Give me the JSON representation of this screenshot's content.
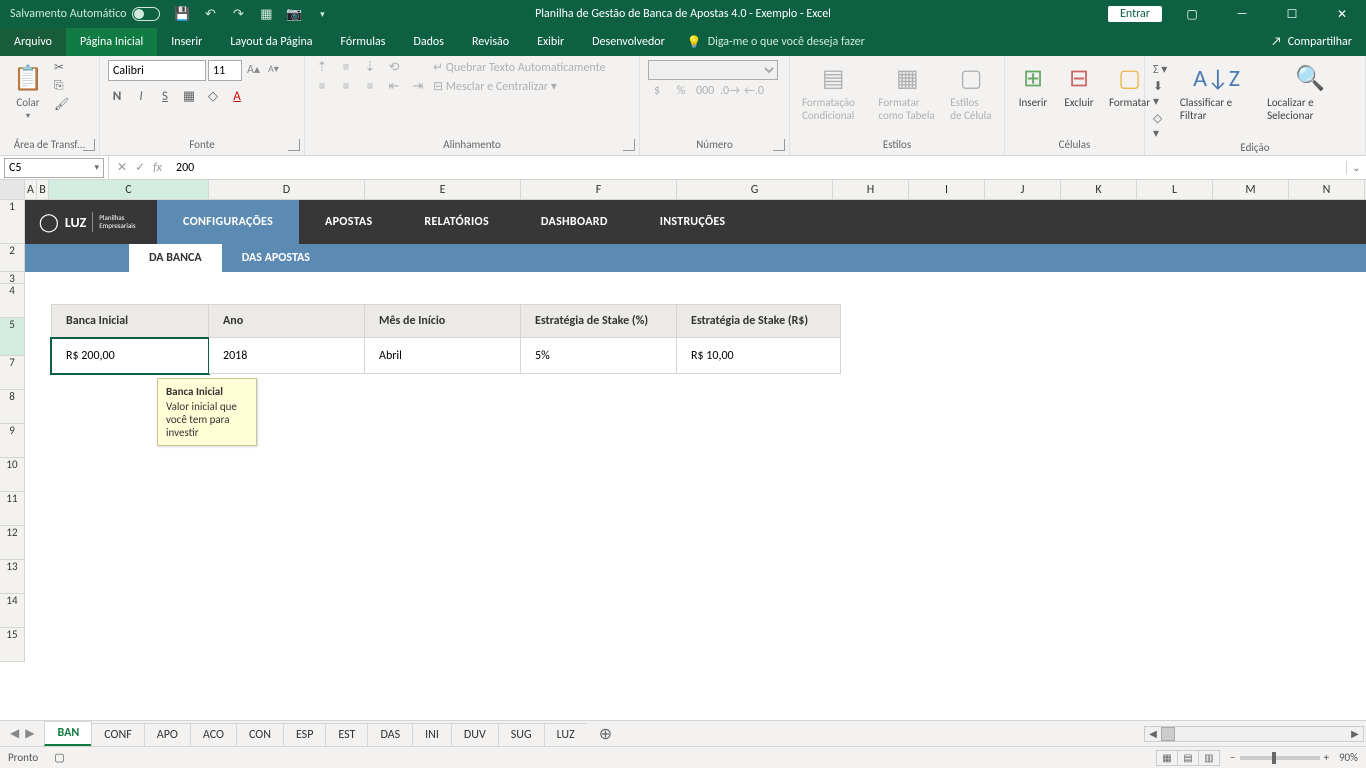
{
  "titlebar": {
    "autosave": "Salvamento Automático",
    "title": "Planilha de Gestão de Banca de Apostas 4.0 - Exemplo  -  Excel",
    "enter": "Entrar"
  },
  "menu": {
    "file": "Arquivo",
    "home": "Página Inicial",
    "insert": "Inserir",
    "layout": "Layout da Página",
    "formulas": "Fórmulas",
    "data": "Dados",
    "review": "Revisão",
    "view": "Exibir",
    "developer": "Desenvolvedor",
    "tellme": "Diga-me o que você deseja fazer",
    "share": "Compartilhar"
  },
  "ribbon": {
    "clipboard": {
      "paste": "Colar",
      "group": "Área de Transf..."
    },
    "font": {
      "name": "Calibri",
      "size": "11",
      "group": "Fonte"
    },
    "align": {
      "wrap": "Quebrar Texto Automaticamente",
      "merge": "Mesclar e Centralizar",
      "group": "Alinhamento"
    },
    "number": {
      "group": "Número"
    },
    "styles": {
      "cond": "Formatação Condicional",
      "table": "Formatar como Tabela",
      "cell": "Estilos de Célula",
      "group": "Estilos"
    },
    "cells": {
      "insert": "Inserir",
      "delete": "Excluir",
      "format": "Formatar",
      "group": "Células"
    },
    "editing": {
      "sort": "Classificar e Filtrar",
      "find": "Localizar e Selecionar",
      "group": "Edição"
    }
  },
  "namebox": "C5",
  "formula": "200",
  "colheads": [
    "A",
    "B",
    "C",
    "D",
    "E",
    "F",
    "G",
    "H",
    "I",
    "J",
    "K",
    "L",
    "M",
    "N"
  ],
  "rowheads": [
    "1",
    "2",
    "3",
    "4",
    "5",
    "7",
    "8",
    "9",
    "10",
    "11",
    "12",
    "13",
    "14",
    "15"
  ],
  "sheetNav": {
    "logo1": "LUZ",
    "logo2": "Planilhas Empresariais",
    "tabs": [
      "CONFIGURAÇÕES",
      "APOSTAS",
      "RELATÓRIOS",
      "DASHBOARD",
      "INSTRUÇÕES"
    ],
    "subtabs": [
      "DA BANCA",
      "DAS APOSTAS"
    ]
  },
  "table": {
    "headers": [
      "Banca Inicial",
      "Ano",
      "Mês de Início",
      "Estratégia de Stake (%)",
      "Estratégia de Stake (R$)"
    ],
    "values": [
      "R$ 200,00",
      "2018",
      "Abril",
      "5%",
      "R$ 10,00"
    ]
  },
  "tooltip": {
    "title": "Banca Inicial",
    "body": "Valor inicial que você tem para investir"
  },
  "sheets": [
    "BAN",
    "CONF",
    "APO",
    "ACO",
    "CON",
    "ESP",
    "EST",
    "DAS",
    "INI",
    "DUV",
    "SUG",
    "LUZ"
  ],
  "status": {
    "ready": "Pronto",
    "zoom": "90%"
  }
}
